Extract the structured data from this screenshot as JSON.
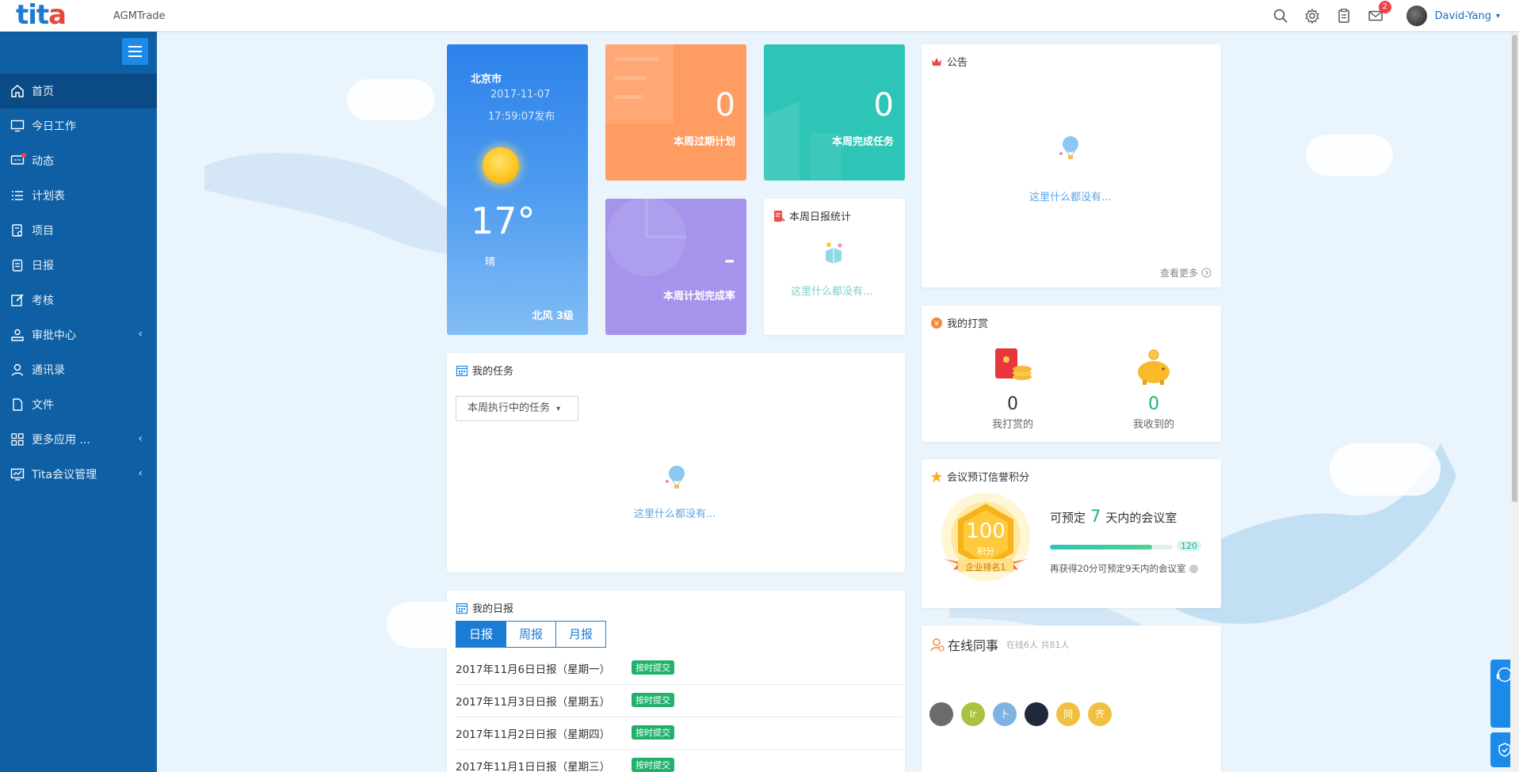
{
  "topbar": {
    "logo_main": "tit",
    "logo_accent": "a",
    "company": "AGMTrade",
    "mail_badge": "2",
    "user_name": "David-Yang",
    "user_caret": "▾"
  },
  "sidebar": {
    "items": [
      {
        "label": "首页"
      },
      {
        "label": "今日工作"
      },
      {
        "label": "动态"
      },
      {
        "label": "计划表"
      },
      {
        "label": "项目"
      },
      {
        "label": "日报"
      },
      {
        "label": "考核"
      },
      {
        "label": "审批中心"
      },
      {
        "label": "通讯录"
      },
      {
        "label": "文件"
      },
      {
        "label": "更多应用 ..."
      },
      {
        "label": "Tita会议管理"
      }
    ],
    "arrow": "‹"
  },
  "weather": {
    "city": "北京市",
    "date": "2017-11-07",
    "time": "17:59:07发布",
    "temp": "17°",
    "condition": "晴",
    "wind": "北风 3级"
  },
  "stats": {
    "overdue": {
      "value": "0",
      "label": "本周过期计划"
    },
    "done": {
      "value": "0",
      "label": "本周完成任务"
    },
    "rate": {
      "value": "-",
      "label": "本周计划完成率"
    }
  },
  "daily_stats": {
    "title": "本周日报统计",
    "empty": "这里什么都没有..."
  },
  "notice": {
    "title": "公告",
    "empty": "这里什么都没有...",
    "more": "查看更多"
  },
  "tasks": {
    "title": "我的任务",
    "filter": "本周执行中的任务",
    "filter_caret": "▾",
    "empty": "这里什么都没有..."
  },
  "reward": {
    "title": "我的打赏",
    "given_value": "0",
    "given_label": "我打赏的",
    "received_value": "0",
    "received_label": "我收到的"
  },
  "meeting": {
    "title": "会议预订信誉积分",
    "score": "100",
    "score_unit": "积分",
    "rank": "企业排名1",
    "line_prefix": "可预定",
    "days": "7",
    "line_suffix": "天内的会议室",
    "progress_value": 100,
    "progress_max": 120,
    "progress_max_label": "120",
    "tip": "再获得20分可预定9天内的会议室"
  },
  "reports": {
    "title": "我的日报",
    "tabs": [
      "日报",
      "周报",
      "月报"
    ],
    "rows": [
      {
        "title": "2017年11月6日日报（星期一）",
        "tag": "按时提交"
      },
      {
        "title": "2017年11月3日日报（星期五）",
        "tag": "按时提交"
      },
      {
        "title": "2017年11月2日日报（星期四）",
        "tag": "按时提交"
      },
      {
        "title": "2017年11月1日日报（星期三）",
        "tag": "按时提交"
      }
    ]
  },
  "online": {
    "title": "在线同事",
    "summary": "在线6人 共81人",
    "avatars": [
      {
        "text": "",
        "color": "#6b6b6b"
      },
      {
        "text": "Ir",
        "color": "#a9c23f"
      },
      {
        "text": "卜",
        "color": "#7fb2e0"
      },
      {
        "text": "",
        "color": "#1e2a3a"
      },
      {
        "text": "同",
        "color": "#f0c040"
      },
      {
        "text": "齐",
        "color": "#f0c040"
      }
    ]
  },
  "float": {
    "consult": "咨询"
  }
}
